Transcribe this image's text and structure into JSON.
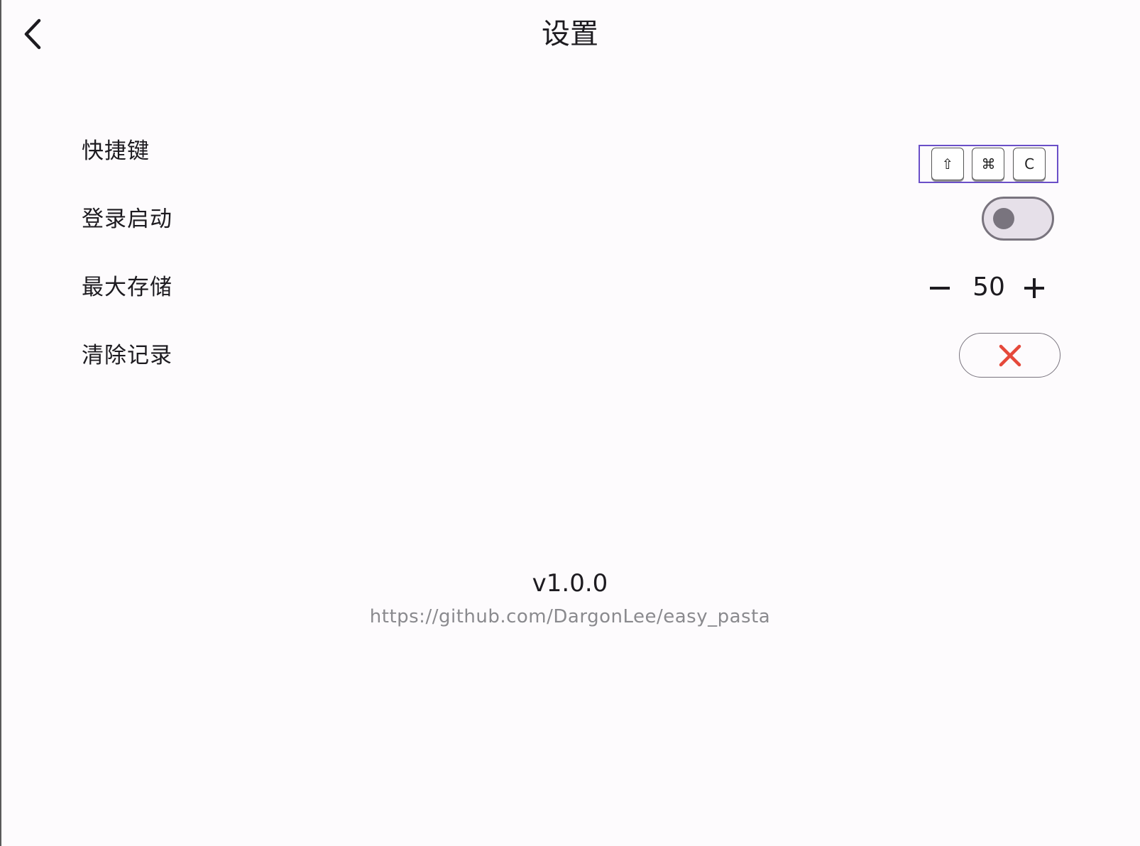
{
  "header": {
    "title": "设置",
    "back_icon": "chevron-left-icon"
  },
  "settings": {
    "shortcut": {
      "label": "快捷键",
      "keys": [
        "⇧",
        "⌘",
        "C"
      ],
      "key_icons": [
        "shift-icon",
        "command-icon"
      ]
    },
    "launch_at_login": {
      "label": "登录启动",
      "enabled": false
    },
    "max_storage": {
      "label": "最大存储",
      "value": "50",
      "decrement_icon": "minus-icon",
      "increment_icon": "plus-icon"
    },
    "clear_history": {
      "label": "清除记录",
      "icon": "close-icon",
      "icon_color": "#e5483a"
    }
  },
  "footer": {
    "version": "v1.0.0",
    "repo_url": "https://github.com/DargonLee/easy_pasta"
  },
  "colors": {
    "background": "#fdfbfd",
    "focus_outline": "#6a4fc8",
    "toggle_track": "#e6e0e9",
    "toggle_outline": "#79747e",
    "link_gray": "#8a8a8e"
  }
}
